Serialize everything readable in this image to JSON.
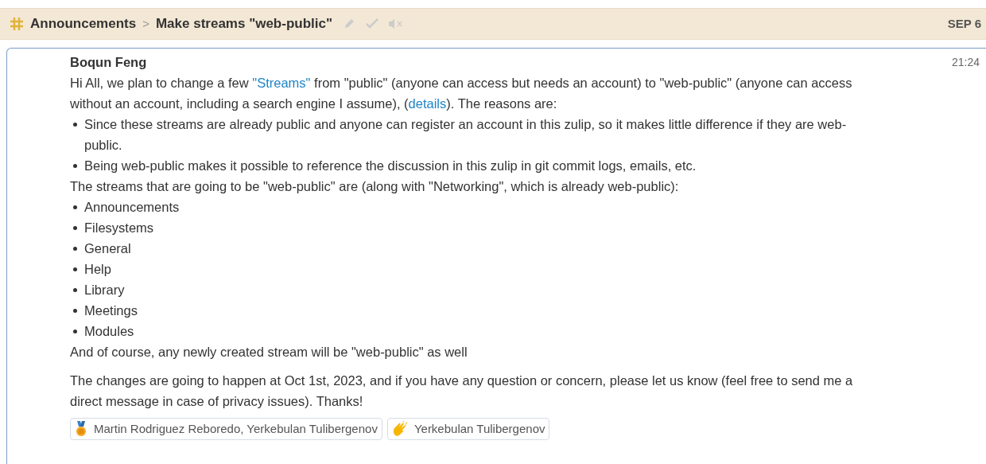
{
  "header": {
    "stream": "Announcements",
    "separator": ">",
    "topic": "Make streams \"web-public\"",
    "date": "SEP 6"
  },
  "message": {
    "sender": "Boqun Feng",
    "time": "21:24",
    "blocks": [
      {
        "kind": "paragraph",
        "parts": [
          {
            "kind": "text",
            "text": "Hi All, we plan to change a few "
          },
          {
            "kind": "link",
            "text": "\"Streams\""
          },
          {
            "kind": "text",
            "text": " from \"public\" (anyone can access but needs an account) to \"web-public\" (anyone can access without an account, including a search engine I assume), ("
          },
          {
            "kind": "link",
            "text": "details"
          },
          {
            "kind": "text",
            "text": "). The reasons are:"
          }
        ]
      },
      {
        "kind": "list",
        "items": [
          "Since these streams are already public and anyone can register an account in this zulip, so it makes little difference if they are web-public.",
          "Being web-public makes it possible to reference the discussion in this zulip in git commit logs, emails, etc."
        ]
      },
      {
        "kind": "paragraph",
        "parts": [
          {
            "kind": "text",
            "text": "The streams that are going to be \"web-public\" are (along with \"Networking\", which is already web-public):"
          }
        ]
      },
      {
        "kind": "list",
        "items": [
          "Announcements",
          "Filesystems",
          "General",
          "Help",
          "Library",
          "Meetings",
          "Modules"
        ]
      },
      {
        "kind": "paragraph",
        "parts": [
          {
            "kind": "text",
            "text": "And of course, any newly created stream will be \"web-public\" as well"
          }
        ]
      },
      {
        "kind": "paragraph",
        "parts": [
          {
            "kind": "text",
            "text": "The changes are going to happen at Oct 1st, 2023, and if you have any question or concern, please let us know (feel free to send me a direct message in case of privacy issues). Thanks!"
          }
        ]
      }
    ],
    "reactions": [
      {
        "kind": "medal",
        "names": "Martin Rodriguez Reboredo, Yerkebulan Tulibergenov"
      },
      {
        "kind": "clap",
        "names": "Yerkebulan Tulibergenov"
      }
    ]
  }
}
